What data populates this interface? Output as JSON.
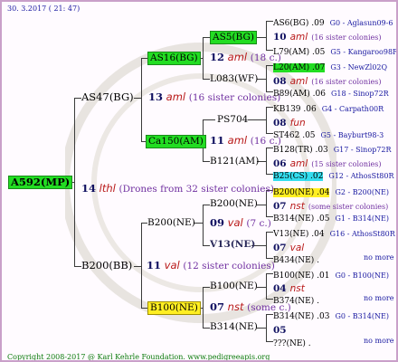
{
  "header": {
    "date": "30.  3.2017 ( 21: 47)"
  },
  "footer": {
    "copyright": "Copyright 2008-2017 @ Karl Kehrle Foundation.   www.pedigreeapis.org"
  },
  "root": {
    "label": "A592(MP)"
  },
  "gen1": {
    "num": "14",
    "mark": "lthl",
    "note": "(Drones from 32 sister colonies)",
    "upper": {
      "label": "AS47(BG)",
      "num": "13",
      "mark": "aml",
      "note": "(16 sister colonies)"
    },
    "lower": {
      "label": "B200(BB)",
      "num": "11",
      "mark": "val",
      "note": "(12 sister colonies)"
    }
  },
  "gen2": {
    "as16": {
      "label": "AS16(BG)",
      "num": "12",
      "mark": "aml",
      "note": "(18 c.)"
    },
    "ca150": {
      "label": "Ca150(AM)",
      "num": "11",
      "mark": "aml",
      "note": "(16 c.)"
    },
    "b200ne": {
      "label": "B200(NE)",
      "num": "09",
      "mark": "val",
      "note": "(7 c.)"
    },
    "b100ne": {
      "label": "B100(NE)",
      "num": "07",
      "mark": "nst",
      "note": "(some c.)"
    }
  },
  "gen3": {
    "as5": {
      "label": "AS5(BG)"
    },
    "l083": {
      "label": "L083(WF)"
    },
    "ps704": {
      "label": "PS704"
    },
    "b121": {
      "label": "B121(AM)"
    },
    "b200": {
      "label": "B200(NE)"
    },
    "v13": {
      "label": "V13(NE)"
    },
    "b100": {
      "label": "B100(NE)"
    },
    "b314": {
      "label": "B314(NE)"
    }
  },
  "gen4": [
    {
      "a": "AS6(BG) .09",
      "b": "G0 - Aglasun09-6"
    },
    {
      "num": "10",
      "mark": "aml",
      "note": "(16 sister colonies)"
    },
    {
      "a": "L79(AM) .05",
      "b": "G5 - Kangaroo98R"
    },
    {
      "a": "L20(AM) .07",
      "b": "G3 - NewZl02Q",
      "hl": "green"
    },
    {
      "num": "08",
      "mark": "aml",
      "note": "(16 sister colonies)"
    },
    {
      "a": "B89(AM) .06",
      "b": "G18 - Sinop72R"
    },
    {
      "a": "KB139 .06",
      "b": "G4 - Carpath00R"
    },
    {
      "num": "08",
      "mark": "fun",
      "note": ""
    },
    {
      "a": "ST462 .05",
      "b": "G5 - Bayburt98-3"
    },
    {
      "a": "B128(TR) .03",
      "b": "G17 - Sinop72R"
    },
    {
      "num": "06",
      "mark": "aml",
      "note": "(15 sister colonies)"
    },
    {
      "a": "B25(CS) .02",
      "b": "G12 - AthosSt80R",
      "hl": "cyan"
    },
    {
      "a": "B200(NE) .04",
      "b": "G2 - B200(NE)",
      "hl": "yellow"
    },
    {
      "num": "07",
      "mark": "nst",
      "note": "(some sister colonies)"
    },
    {
      "a": "B314(NE) .05",
      "b": "G1 - B314(NE)"
    },
    {
      "a": "V13(NE) .04",
      "b": "G16 - AthosSt80R"
    },
    {
      "num": "07",
      "mark": "val",
      "note": ""
    },
    {
      "a": "B434(NE) .",
      "b": "no more"
    },
    {
      "a": "B100(NE) .01",
      "b": "G0 - B100(NE)"
    },
    {
      "num": "04",
      "mark": "nst",
      "note": ""
    },
    {
      "a": "B374(NE) .",
      "b": "no more"
    },
    {
      "a": "B314(NE) .03",
      "b": "G0 - B314(NE)"
    },
    {
      "num": "05",
      "mark": "",
      "note": ""
    },
    {
      "a": "???(NE) .",
      "b": "no more"
    }
  ]
}
